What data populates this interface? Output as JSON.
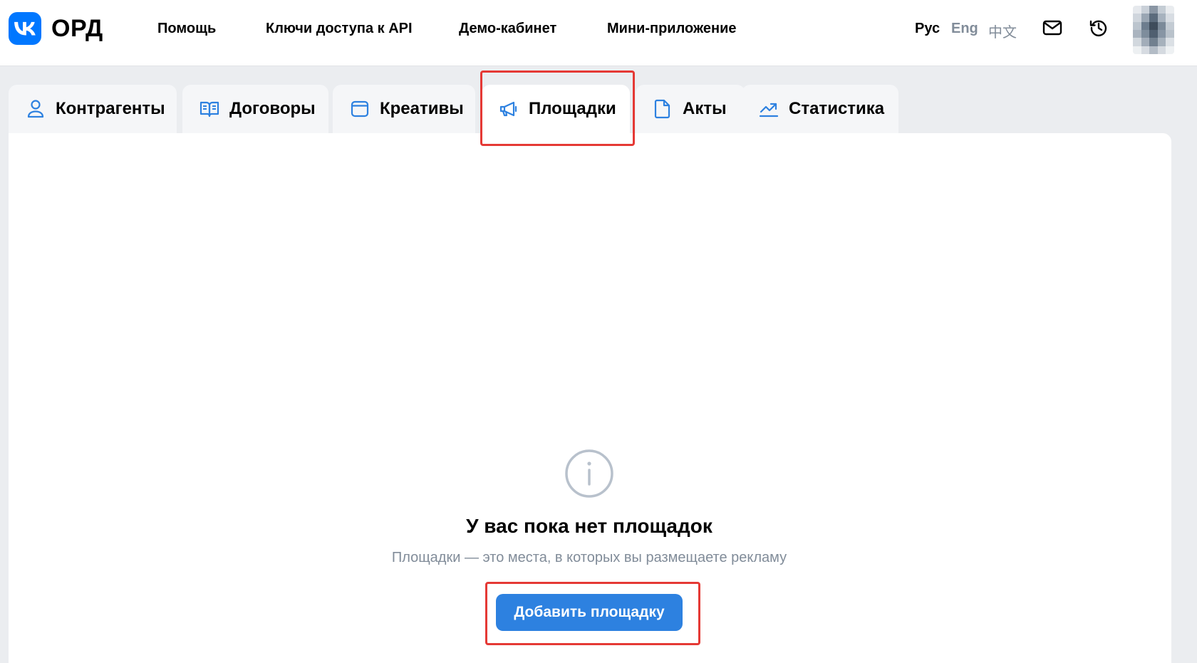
{
  "header": {
    "logo_text": "ОРД",
    "nav": [
      "Помощь",
      "Ключи доступа к API",
      "Демо-кабинет",
      "Мини-приложение"
    ],
    "languages": {
      "ru": "Рус",
      "en": "Eng",
      "zh": "中文"
    },
    "active_language": "Рус",
    "icons": [
      "mail-icon",
      "history-icon"
    ]
  },
  "tabs": [
    {
      "label": "Контрагенты",
      "icon": "person-icon"
    },
    {
      "label": "Договоры",
      "icon": "book-icon"
    },
    {
      "label": "Креативы",
      "icon": "window-icon"
    },
    {
      "label": "Площадки",
      "icon": "megaphone-icon",
      "active": true
    },
    {
      "label": "Акты",
      "icon": "document-icon"
    },
    {
      "label": "Статистика",
      "icon": "chart-up-icon"
    }
  ],
  "empty_state": {
    "icon": "info-icon",
    "title": "У вас пока нет площадок",
    "subtitle": "Площадки — это места, в которых вы размещаете рекламу",
    "button_label": "Добавить площадку"
  },
  "colors": {
    "brand": "#0077ff",
    "button": "#2d81e0",
    "highlight": "#e53935",
    "muted_text": "#818c99",
    "tab_icon": "#2d81e0"
  }
}
